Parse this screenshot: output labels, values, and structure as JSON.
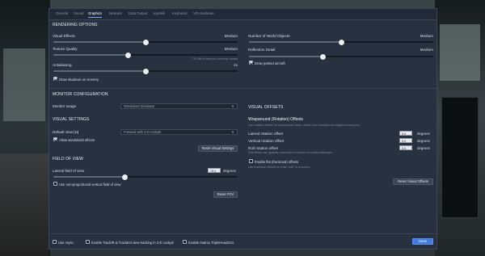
{
  "tabs": [
    "General",
    "Sound",
    "Graphics",
    "Network",
    "Data Output",
    "Joystick",
    "Keyboard",
    "VR Hardware"
  ],
  "active_tab": "Graphics",
  "rendering": {
    "title": "RENDERING OPTIONS",
    "visual_effects": {
      "label": "Visual Effects",
      "value": "Medium",
      "level": 0.5
    },
    "texture_quality": {
      "label": "Texture Quality",
      "value": "Medium",
      "level": 0.43,
      "note": "711 MB of textures currently loaded"
    },
    "antialiasing": {
      "label": "Antialiasing",
      "value": "4x",
      "level": 0.5
    },
    "draw_shadows": {
      "label": "Draw shadows on scenery",
      "checked": true
    },
    "world_objects": {
      "label": "Number of World Objects",
      "value": "Medium",
      "level": 0.5
    },
    "reflection_detail": {
      "label": "Reflection Detail",
      "value": "Medium",
      "level": 0.4
    },
    "parked_aircraft": {
      "label": "Draw parked aircraft",
      "checked": true
    }
  },
  "monitor": {
    "title": "MONITOR CONFIGURATION",
    "usage_label": "Monitor usage",
    "usage_value": "Windowed Simulator"
  },
  "visual_settings": {
    "title": "VISUAL SETTINGS",
    "default_view_label": "Default view [w]",
    "default_view_value": "Forward with 3-D cockpit",
    "windshield": {
      "label": "Allow windshield effects",
      "checked": true
    },
    "reset_button": "Reset Visual Settings"
  },
  "fov": {
    "title": "FIELD OF VIEW",
    "lateral_label": "Lateral field of view",
    "lateral_value": "75.0",
    "unit": "degrees",
    "level": 0.45,
    "nonprop": {
      "label": "Use non-proportional vertical field of view",
      "checked": false
    },
    "reset_button": "Reset FOV"
  },
  "offsets": {
    "title": "VISUAL OFFSETS",
    "subtitle": "Wraparound (Rotation) Offsets",
    "desc": "Use rotation offsets for wraparound views, where your monitors are angled around you.",
    "lateral": {
      "label": "Lateral rotation offset",
      "value": "0.0"
    },
    "vertical": {
      "label": "Vertical rotation offset",
      "value": "0.0"
    },
    "roll": {
      "label": "Roll rotation offset",
      "value": "0.0",
      "note": "Roll offsets are typically used when a monitor is rotated sideways."
    },
    "unit": "degrees",
    "flat": {
      "label": "Enable flat (fractional) offsets",
      "checked": false,
      "note": "Use fractional offsets for a flat \"wall\" of monitors."
    },
    "reset_button": "Reset Visual Offsets"
  },
  "footer": {
    "vsync": {
      "label": "Use vsync",
      "checked": false
    },
    "trackir": {
      "label": "Enable TrackIR & Tracktrol view tracking in 3-D cockpit",
      "checked": false
    },
    "matrox": {
      "label": "Enable Matrox TripleHead2Go",
      "checked": false
    },
    "done": "Done"
  },
  "colors": {
    "accent": "#3f7be0",
    "panel": "#27313f"
  }
}
